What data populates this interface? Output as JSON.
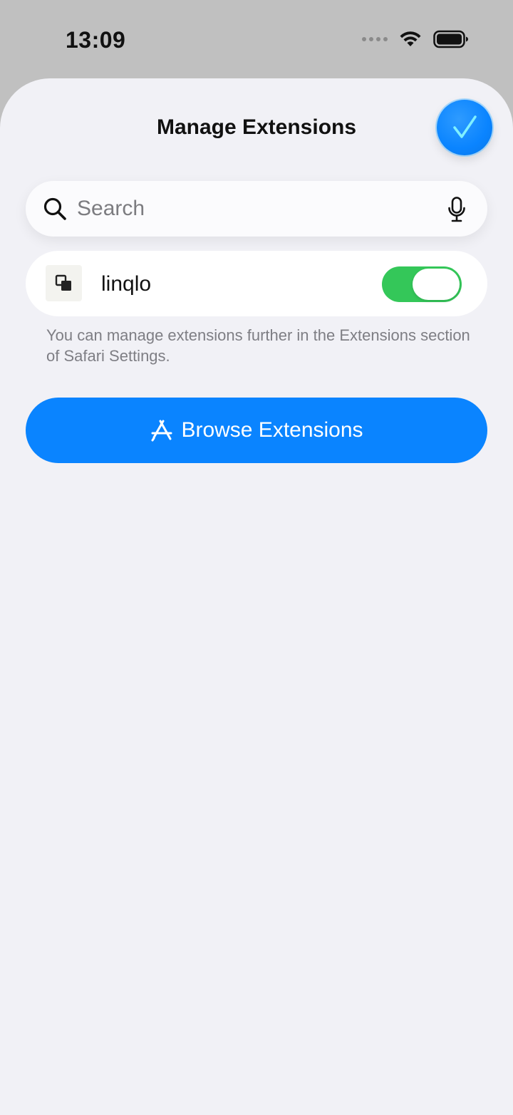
{
  "status_bar": {
    "time": "13:09",
    "icons": [
      "signal-dots-icon",
      "wifi-icon",
      "battery-icon"
    ]
  },
  "sheet": {
    "title": "Manage Extensions",
    "done_icon": "checkmark-icon"
  },
  "search": {
    "placeholder": "Search",
    "value": ""
  },
  "extensions": [
    {
      "name": "linqlo",
      "enabled": true
    }
  ],
  "footnote": "You can manage extensions further in the Extensions section of Safari Settings.",
  "browse_button": {
    "label": "Browse Extensions",
    "icon": "app-store-icon"
  },
  "colors": {
    "accent": "#0a84ff",
    "toggle_on": "#34c759",
    "sheet_bg": "#f1f1f6"
  }
}
